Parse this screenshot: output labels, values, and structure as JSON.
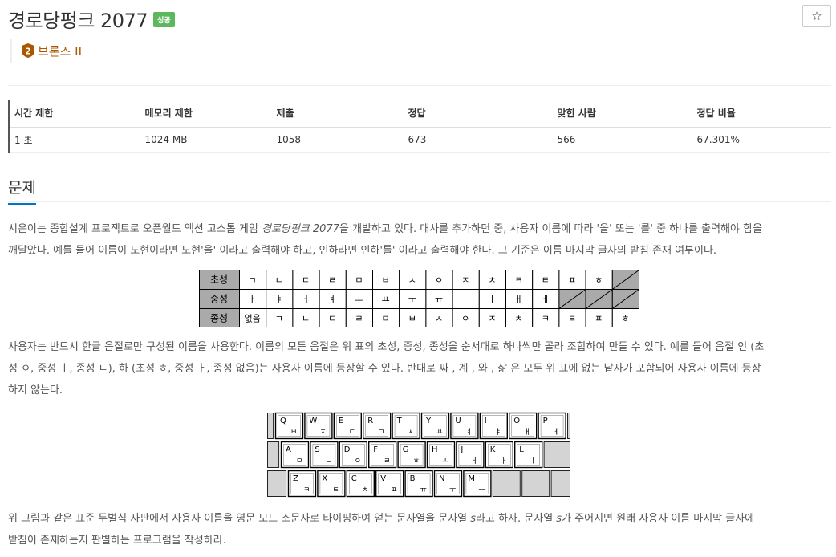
{
  "header": {
    "title": "경로당펑크 2077",
    "status_badge": "성공",
    "star_label": "☆",
    "tier_number": "2",
    "tier_label": "브론즈 II"
  },
  "info": {
    "headers": [
      "시간 제한",
      "메모리 제한",
      "제출",
      "정답",
      "맞힌 사람",
      "정답 비율"
    ],
    "values": [
      "1 초",
      "1024 MB",
      "1058",
      "673",
      "566",
      "67.301%"
    ]
  },
  "problem": {
    "section_title": "문제",
    "para1_line1_a": "시은이는 종합설계 프로젝트로 오픈월드 액션 고스톱 게임 ",
    "para1_game": "경로당펑크 2077",
    "para1_line1_b": "을 개발하고 있다. 대사를 추가하던 중, 사용자 이름에 따라 '을' 또는 '를' 중 하나를 출력해야 함을",
    "para1_line2": "깨달았다. 예를 들어 이름이 도현이라면 도현'을' 이라고 출력해야 하고, 인하라면 인하'를' 이라고 출력해야 한다. 그 기준은 이름 마지막 글자의 받침 존재 여부이다.",
    "para2_line1": "사용자는 반드시 한글 음절로만 구성된 이름을 사용한다. 이름의 모든 음절은 위 표의 초성, 중성, 종성을 순서대로 하나씩만 골라 조합하여 만들 수 있다. 예를 들어 음절  인 (초",
    "para2_line2": "성 ㅇ, 중성 ㅣ, 종성 ㄴ),  하 (초성 ㅎ, 중성 ㅏ, 종성 없음)는 사용자 이름에 등장할 수 있다. 반대로  짜 ,  계 ,  와 ,  삶 은 모두 위 표에 없는 낱자가 포함되어 사용자 이름에 등장",
    "para2_line3": "하지 않는다.",
    "para3_line1_a": "위 그림과 같은 표준 두벌식 자판에서 사용자 이름을 영문 모드 소문자로 타이핑하여 얻는 문자열을 문자열 ",
    "para3_s": "s",
    "para3_line1_b": "라고 하자. 문자열 ",
    "para3_s2": "s",
    "para3_line1_c": "가 주어지면 원래 사용자 이름 마지막 글자에",
    "para3_line2": "받침이 존재하는지 판별하는 프로그램을 작성하라."
  },
  "jamo_table": {
    "rows": [
      {
        "label": "초성",
        "cells": [
          "ㄱ",
          "ㄴ",
          "ㄷ",
          "ㄹ",
          "ㅁ",
          "ㅂ",
          "ㅅ",
          "ㅇ",
          "ㅈ",
          "ㅊ",
          "ㅋ",
          "ㅌ",
          "ㅍ",
          "ㅎ"
        ]
      },
      {
        "label": "중성",
        "cells": [
          "ㅏ",
          "ㅑ",
          "ㅓ",
          "ㅕ",
          "ㅗ",
          "ㅛ",
          "ㅜ",
          "ㅠ",
          "ㅡ",
          "ㅣ",
          "ㅐ",
          "ㅔ"
        ]
      },
      {
        "label": "종성",
        "cells": [
          "없음",
          "ㄱ",
          "ㄴ",
          "ㄷ",
          "ㄹ",
          "ㅁ",
          "ㅂ",
          "ㅅ",
          "ㅇ",
          "ㅈ",
          "ㅊ",
          "ㅋ",
          "ㅌ",
          "ㅍ",
          "ㅎ"
        ]
      }
    ]
  },
  "keyboard": {
    "rows": [
      [
        {
          "en": "Q",
          "ko": "ㅂ"
        },
        {
          "en": "W",
          "ko": "ㅈ"
        },
        {
          "en": "E",
          "ko": "ㄷ"
        },
        {
          "en": "R",
          "ko": "ㄱ"
        },
        {
          "en": "T",
          "ko": "ㅅ"
        },
        {
          "en": "Y",
          "ko": "ㅛ"
        },
        {
          "en": "U",
          "ko": "ㅕ"
        },
        {
          "en": "I",
          "ko": "ㅑ"
        },
        {
          "en": "O",
          "ko": "ㅐ"
        },
        {
          "en": "P",
          "ko": "ㅔ"
        }
      ],
      [
        {
          "en": "A",
          "ko": "ㅁ"
        },
        {
          "en": "S",
          "ko": "ㄴ"
        },
        {
          "en": "D",
          "ko": "ㅇ"
        },
        {
          "en": "F",
          "ko": "ㄹ"
        },
        {
          "en": "G",
          "ko": "ㅎ"
        },
        {
          "en": "H",
          "ko": "ㅗ"
        },
        {
          "en": "J",
          "ko": "ㅓ"
        },
        {
          "en": "K",
          "ko": "ㅏ"
        },
        {
          "en": "L",
          "ko": "ㅣ"
        }
      ],
      [
        {
          "en": "Z",
          "ko": "ㅋ"
        },
        {
          "en": "X",
          "ko": "ㅌ"
        },
        {
          "en": "C",
          "ko": "ㅊ"
        },
        {
          "en": "V",
          "ko": "ㅍ"
        },
        {
          "en": "B",
          "ko": "ㅠ"
        },
        {
          "en": "N",
          "ko": "ㅜ"
        },
        {
          "en": "M",
          "ko": "ㅡ"
        }
      ]
    ]
  },
  "colors": {
    "success": "#5cb85c",
    "bronze": "#ad5600",
    "section_underline": "#0076c0",
    "table_header_gray": "#aaaaaa"
  }
}
